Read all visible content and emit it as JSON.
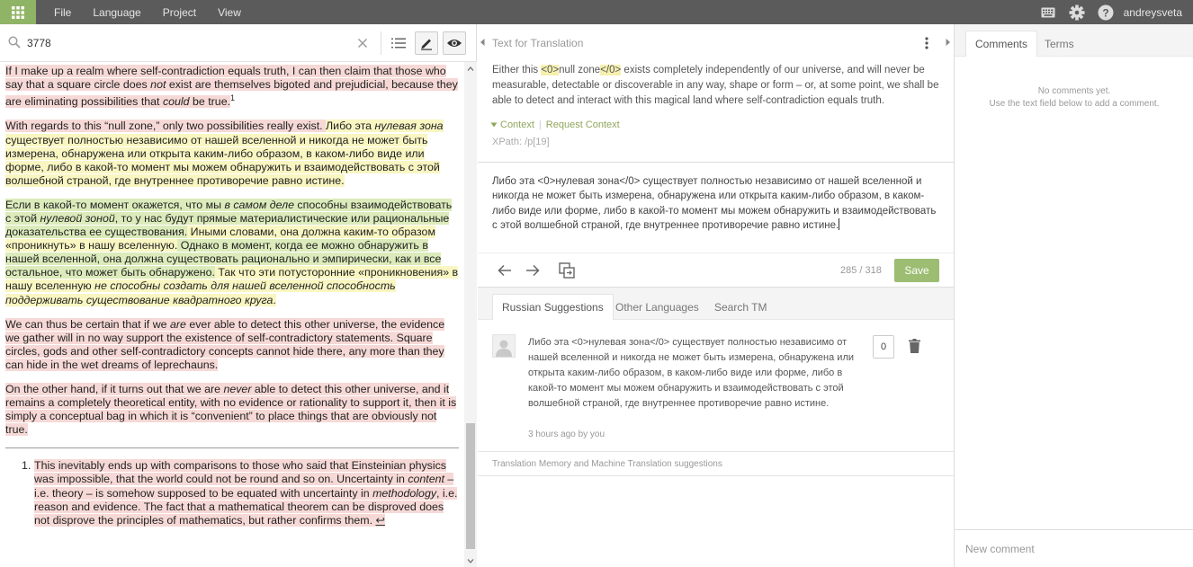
{
  "menu": {
    "file": "File",
    "language": "Language",
    "project": "Project",
    "view": "View"
  },
  "user": {
    "name": "andreysveta"
  },
  "search": {
    "value": "3778"
  },
  "doc": {
    "p1": {
      "a": "If I make up a realm where self-contradiction equals truth, I can then claim that those who say that a square circle does ",
      "b": "not",
      "c": " exist are themselves bigoted and prejudicial, because they are eliminating possibilities that ",
      "d": "could",
      "e": " be true.",
      "sup": "1"
    },
    "p2": {
      "a": "With regards to this “null zone,” only two possibilities really exist. ",
      "b": "Либо эта ",
      "c": "нулевая зона",
      "d": " существует полностью независимо от нашей вселенной и никогда не может быть измерена, обнаружена или открыта каким-либо образом, в каком-либо виде или форме, либо в какой-то момент мы можем обнаружить и взаимодействовать с этой волшебной страной, где внутреннее противоречие равно истине."
    },
    "p3": {
      "a": "Если в какой-то момент окажется, что мы ",
      "b": "в самом деле",
      "c": " способны взаимодействовать с этой ",
      "d": "нулевой зоной",
      "e": ", то у нас будут прямые материалистические или рациональные доказательства ее существования.",
      "f": " Иными словами, она должна каким-то образом «проникнуть» в нашу вселенную.",
      "g": " Однако в момент, когда ее можно обнаружить в нашей вселенной, она должна существовать рационально и эмпирически, как и все остальное, что может быть обнаружено.",
      "h": " Так что эти потусторонние «проникновения» в нашу вселенную ",
      "i": "не способны создать для нашей вселенной способность поддерживать существование квадратного круга",
      "j": "."
    },
    "p4": {
      "a": "We can thus be certain that if we ",
      "b": "are",
      "c": " ever able to detect this other universe, the evidence we gather will in no way support the existence of self-contradictory statements. Square circles, gods and other self-contradictory concepts cannot hide there, any more than they can hide in the wet dreams of leprechauns."
    },
    "p5": {
      "a": "On the other hand, if it turns out that we are ",
      "b": "never",
      "c": " able to detect this other universe, and it remains a completely theoretical entity, with no evidence or rationality to support it, then it is simply a conceptual bag in which it is “convenient” to place things that are obviously not true."
    },
    "fn": {
      "num": "1.",
      "a": "This inevitably ends up with comparisons to those who said that Einsteinian physics was impossible, that the world could not be round and so on. Uncertainty in ",
      "b": "content",
      "c": " – i.e. theory – is somehow supposed to be equated with uncertainty in ",
      "d": "methodology",
      "e": ", i.e. reason and evidence. The fact that a mathematical theorem can be disproved does not disprove the principles of mathematics, but rather confirms them. ",
      "back": "↩"
    }
  },
  "translation": {
    "label": "Text for Translation",
    "source": {
      "a": "Either this ",
      "tag_open": "<0>",
      "b": "null zone",
      "tag_close": "</0>",
      "c": " exists completely independently of our universe, and will never be measurable, detectable or discoverable in any way, shape or form – or, at some point, we shall be able to detect and interact with this magical land where self-contradiction equals truth."
    },
    "context": "Context",
    "request_context": "Request Context",
    "xpath": "XPath: /p[19]",
    "target": "Либо эта <0>нулевая зона</0> существует полностью независимо от нашей вселенной и никогда не может быть измерена, обнаружена или открыта каким-либо образом, в каком-либо виде или форме, либо в какой-то момент мы можем обнаружить и взаимодействовать с этой волшебной страной, где внутреннее противоречие равно истине.",
    "char_count": "285 / 318",
    "save": "Save"
  },
  "suggest_tabs": {
    "russian": "Russian Suggestions",
    "other": "Other Languages",
    "tm": "Search TM"
  },
  "suggestion": {
    "text": "Либо эта <0>нулевая зона</0> существует полностью независимо от нашей вселенной и никогда не может быть измерена, обнаружена или открыта каким-либо образом, в каком-либо виде или форме, либо в какой-то момент мы можем обнаружить и взаимодействовать с этой волшебной страной, где внутреннее противоречие равно истине.",
    "meta": "3 hours ago by you",
    "votes": "0"
  },
  "tm_label": "Translation Memory and Machine Translation suggestions",
  "right": {
    "tab_comments": "Comments",
    "tab_terms": "Terms",
    "no_comments": "No comments yet.",
    "no_comments_hint": "Use the text field below to add a comment.",
    "new_comment": "New comment"
  },
  "colors": {
    "accent": "#8fb465",
    "save": "#9cbd72",
    "topbar": "#5b5b5b",
    "pink": "#f6d9d6",
    "yellow": "#f9f6c2",
    "green": "#dcebbb"
  },
  "icons": [
    "apps-grid-icon",
    "keyboard-icon",
    "gear-icon",
    "help-icon",
    "search-icon",
    "close-icon",
    "list-icon",
    "pencil-icon",
    "eye-icon",
    "kebab-icon",
    "arrow-left-icon",
    "arrow-right-icon",
    "copy-icon",
    "avatar-icon",
    "trash-icon"
  ]
}
